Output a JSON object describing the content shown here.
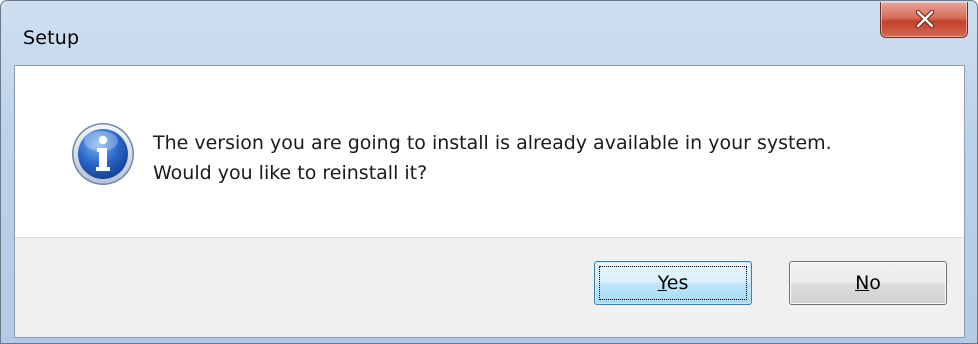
{
  "window": {
    "title": "Setup"
  },
  "message": {
    "line1": "The version you are going to install is already available in your system.",
    "line2": "Would you like to reinstall it?"
  },
  "buttons": {
    "yes": {
      "accel": "Y",
      "rest": "es"
    },
    "no": {
      "accel": "N",
      "rest": "o"
    }
  },
  "icons": {
    "info": "information-icon",
    "close": "close-icon"
  },
  "colors": {
    "title_bar": "#bcd2ea",
    "close_button": "#c5412c",
    "dialog_body": "#ffffff",
    "button_strip": "#f0f0f0",
    "default_button_border": "#3c7fb1"
  }
}
